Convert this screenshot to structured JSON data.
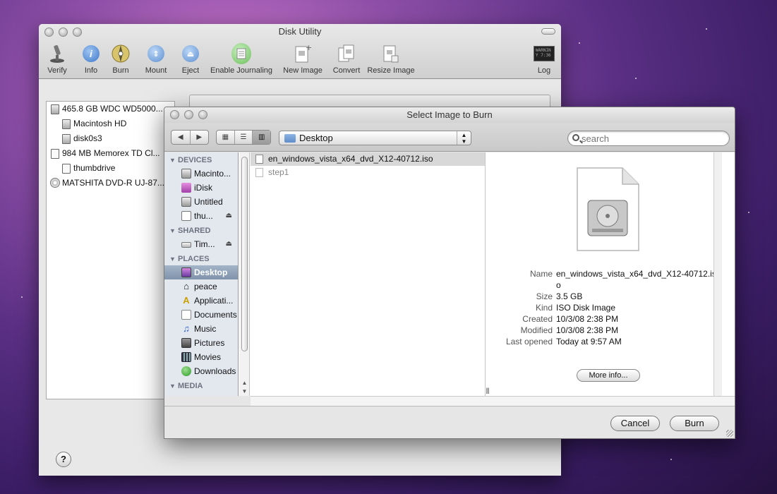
{
  "disk_utility": {
    "title": "Disk Utility",
    "toolbar": {
      "verify": "Verify",
      "info": "Info",
      "burn": "Burn",
      "mount": "Mount",
      "eject": "Eject",
      "enable_journaling": "Enable Journaling",
      "new_image": "New Image",
      "convert": "Convert",
      "resize_image": "Resize Image",
      "log": "Log",
      "log_icon_text": "WARNIN\nY 7:36"
    },
    "sidebar": {
      "items": [
        {
          "label": "465.8 GB WDC WD5000..."
        },
        {
          "label": "Macintosh HD"
        },
        {
          "label": "disk0s3"
        },
        {
          "label": "984 MB Memorex TD Cl..."
        },
        {
          "label": "thumbdrive"
        },
        {
          "label": "MATSHITA DVD-R UJ-87..."
        }
      ]
    },
    "help": "?"
  },
  "sheet": {
    "title": "Select Image to Burn",
    "location": "Desktop",
    "search_placeholder": "search",
    "sections": {
      "devices": "DEVICES",
      "shared": "SHARED",
      "places": "PLACES",
      "media": "MEDIA"
    },
    "devices": [
      {
        "label": "Macinto..."
      },
      {
        "label": "iDisk"
      },
      {
        "label": "Untitled"
      },
      {
        "label": "thu..."
      }
    ],
    "shared": [
      {
        "label": "Tim..."
      }
    ],
    "places": [
      {
        "label": "Desktop"
      },
      {
        "label": "peace"
      },
      {
        "label": "Applicati..."
      },
      {
        "label": "Documents"
      },
      {
        "label": "Music"
      },
      {
        "label": "Pictures"
      },
      {
        "label": "Movies"
      },
      {
        "label": "Downloads"
      }
    ],
    "files": [
      {
        "name": "en_windows_vista_x64_dvd_X12-40712.iso"
      },
      {
        "name": "step1"
      }
    ],
    "preview": {
      "name_key": "Name",
      "name_val": "en_windows_vista_x64_dvd_X12-40712.iso",
      "size_key": "Size",
      "size_val": "3.5 GB",
      "kind_key": "Kind",
      "kind_val": "ISO Disk Image",
      "created_key": "Created",
      "created_val": "10/3/08 2:38 PM",
      "modified_key": "Modified",
      "modified_val": "10/3/08 2:38 PM",
      "opened_key": "Last opened",
      "opened_val": "Today at 9:57 AM",
      "more_info": "More info..."
    },
    "cancel": "Cancel",
    "burn": "Burn"
  },
  "colors": {
    "selection_blue": "#7f93ab",
    "sidebar_bg": "#e3e8ef",
    "desktop_purple": "#5a2f84"
  }
}
